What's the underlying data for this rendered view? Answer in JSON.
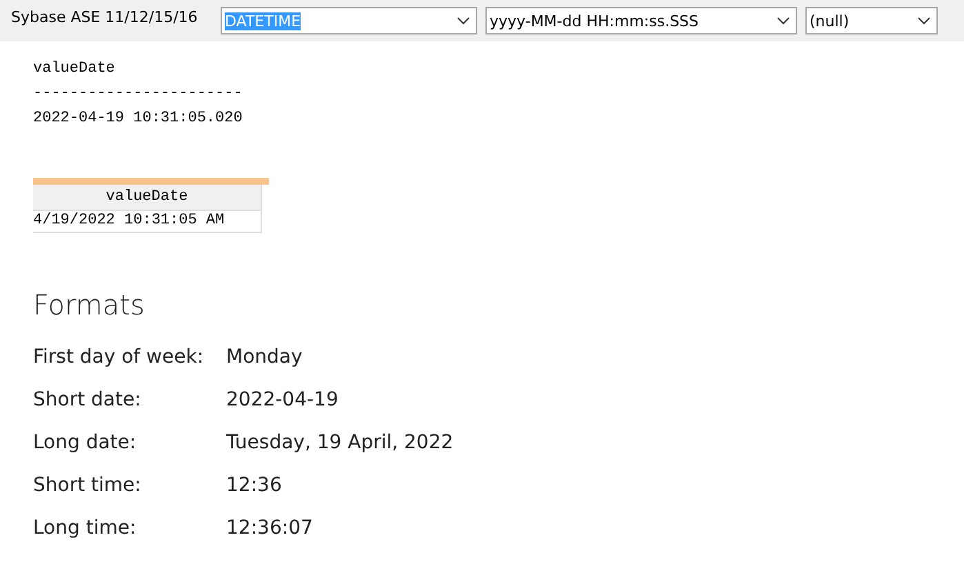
{
  "toolbar": {
    "label": "Sybase ASE 11/12/15/16",
    "dropdowns": [
      {
        "value": "DATETIME",
        "highlighted": true
      },
      {
        "value": "yyyy-MM-dd HH:mm:ss.SSS",
        "highlighted": false
      },
      {
        "value": "(null)",
        "highlighted": false
      }
    ]
  },
  "text_output": {
    "header": "valueDate",
    "separator": "-----------------------",
    "value": "2022-04-19 10:31:05.020"
  },
  "grid_output": {
    "columns": [
      "valueDate"
    ],
    "rows": [
      [
        "4/19/2022 10:31:05 AM"
      ]
    ]
  },
  "formats": {
    "title": "Formats",
    "rows": [
      {
        "label": "First day of week:",
        "value": "Monday"
      },
      {
        "label": "Short date:",
        "value": "2022-04-19"
      },
      {
        "label": "Long date:",
        "value": "Tuesday, 19 April, 2022"
      },
      {
        "label": "Short time:",
        "value": "12:36"
      },
      {
        "label": "Long time:",
        "value": "12:36:07"
      }
    ]
  }
}
